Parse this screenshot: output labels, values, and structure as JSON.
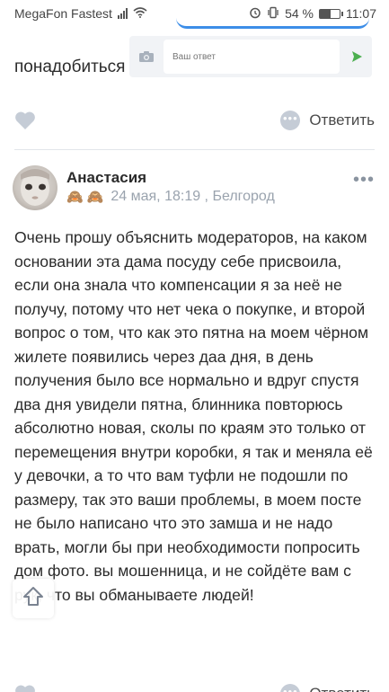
{
  "status_bar": {
    "carrier": "MegaFon Fastest",
    "battery_percent": "54 %",
    "battery_level": 0.54,
    "time": "11:07",
    "icons": [
      "signal-icon",
      "wifi-icon",
      "alarm-icon",
      "vibrate-icon",
      "battery-icon"
    ]
  },
  "reply_form": {
    "previous_text": "понадобиться",
    "placeholder": "Ваш ответ",
    "camera_icon": "camera-icon",
    "send_icon": "send-icon"
  },
  "previous_comment_actions": {
    "reply_label": "Ответить"
  },
  "post": {
    "author": "Анастасия",
    "badges": [
      "🙈",
      "🙈"
    ],
    "date": "24 мая, 18:19 , Белгород",
    "body": "Очень прошу объяснить модераторов, на каком основании эта дама посуду себе присвоила, если она знала что компенсации я за неё не получу, потому что нет чека о покупке, и второй вопрос о том, что как это пятна на моем чёрном жилете появились через даа дня, в день получения было все нормально и вдруг спустя два дня увидели пятна, блинника повторюсь абсолютно новая, сколы по краям это только от перемещения внутри коробки, я так и меняла её у девочки, а то что вам туфли не подошли по размеру, так это ваши проблемы, в моем посте не было написано что это замша и не надо врать, могли бы при необходимости попросить дом фото. вы мошенница, и не сойдёте вам с рук, что вы обманываете людей!",
    "reply_label": "Ответить"
  },
  "colors": {
    "accent": "#3d8ee8",
    "send_green": "#4caf50",
    "muted_icon": "#c5ccd6",
    "meta_text": "#9aa3ae"
  }
}
